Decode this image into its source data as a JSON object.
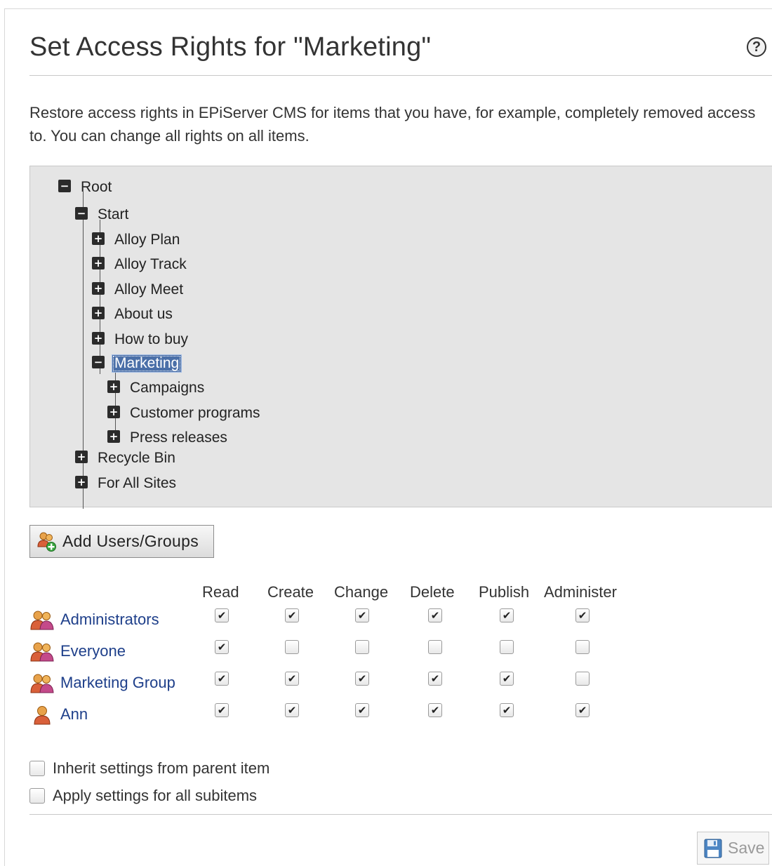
{
  "page": {
    "title": "Set Access Rights for \"Marketing\"",
    "help_symbol": "?",
    "description": "Restore access rights in EPiServer CMS for items that you have, for example, completely removed access to. You can change all rights on all items."
  },
  "tree": {
    "root": "Root",
    "start": "Start",
    "alloy_plan": "Alloy Plan",
    "alloy_track": "Alloy Track",
    "alloy_meet": "Alloy Meet",
    "about_us": "About us",
    "how_to_buy": "How to buy",
    "marketing": "Marketing",
    "campaigns": "Campaigns",
    "customer_programs": "Customer programs",
    "press_releases": "Press releases",
    "recycle_bin": "Recycle Bin",
    "for_all_sites": "For All Sites",
    "expanded_symbol": "−",
    "collapsed_symbol": "+"
  },
  "add_button": {
    "label": "Add Users/Groups"
  },
  "permissions": {
    "columns": [
      "Read",
      "Create",
      "Change",
      "Delete",
      "Publish",
      "Administer"
    ],
    "rows": [
      {
        "name": "Administrators",
        "type": "group",
        "rights": [
          true,
          true,
          true,
          true,
          true,
          true
        ]
      },
      {
        "name": "Everyone",
        "type": "group",
        "rights": [
          true,
          false,
          false,
          false,
          false,
          false
        ]
      },
      {
        "name": "Marketing Group",
        "type": "group",
        "rights": [
          true,
          true,
          true,
          true,
          true,
          false
        ]
      },
      {
        "name": "Ann",
        "type": "user",
        "rights": [
          true,
          true,
          true,
          true,
          true,
          true
        ]
      }
    ],
    "check_symbol": "✔"
  },
  "options": {
    "inherit": {
      "label": "Inherit settings from parent item",
      "checked": false
    },
    "apply_subitems": {
      "label": "Apply settings for all subitems",
      "checked": false
    }
  },
  "save_button": {
    "label": "Save",
    "enabled": false
  },
  "colors": {
    "link": "#1e3f8a",
    "selection": "#4a6fa8",
    "panel": "#e5e5e5"
  }
}
